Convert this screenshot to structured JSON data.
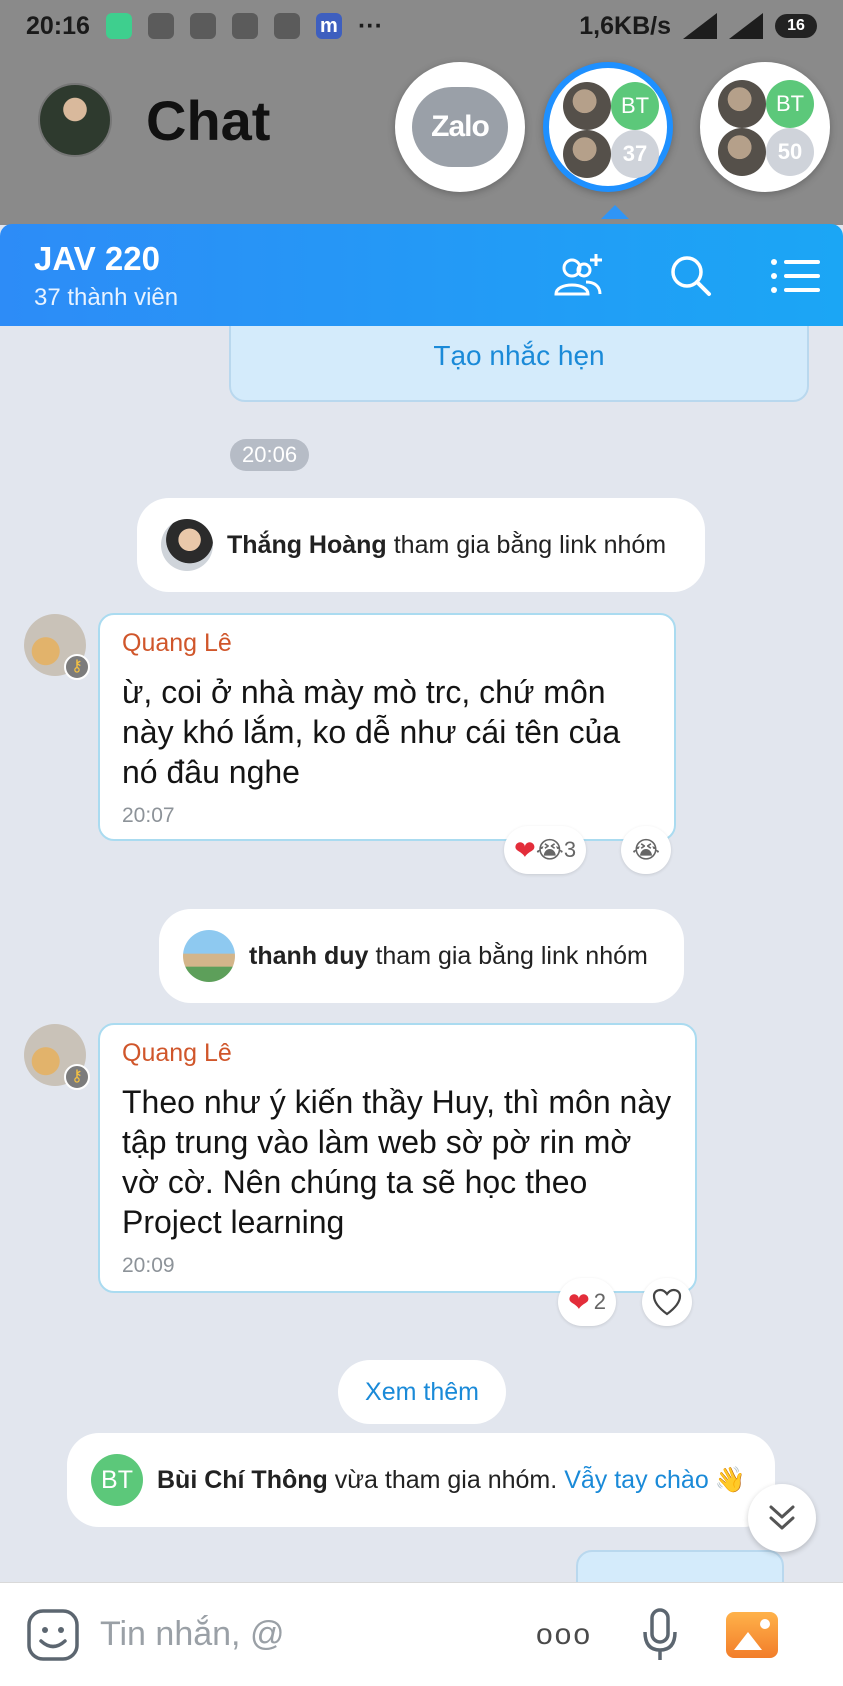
{
  "status_bar": {
    "time": "20:16",
    "network_speed": "1,6KB/s",
    "battery": "16",
    "more": "···",
    "app_icon_letter": "m"
  },
  "background": {
    "title": "Chat",
    "zalo_logo": "Zalo"
  },
  "chat_heads": {
    "group1": {
      "initials": "BT",
      "count": "37"
    },
    "group2": {
      "initials": "BT",
      "count": "50"
    }
  },
  "group_header": {
    "name": "JAV 220",
    "members": "37 thành viên",
    "icons": [
      "add-member-icon",
      "search-icon",
      "menu-icon"
    ]
  },
  "reminder": {
    "button_label": "Tạo nhắc hẹn",
    "time": "20:06"
  },
  "events": [
    {
      "name": "Thắng Hoàng",
      "text": "tham gia bằng link nhóm"
    },
    {
      "name": "thanh duy",
      "text": "tham gia bằng link nhóm"
    }
  ],
  "messages": [
    {
      "sender": "Quang Lê",
      "text": "ừ, coi ở nhà mày mò trc, chứ môn này khó lắm, ko dễ như cái tên của nó đâu nghe",
      "time": "20:07",
      "reaction_count": "3"
    },
    {
      "sender": "Quang Lê",
      "text": "Theo như ý kiến thầy Huy, thì môn này tập trung vào làm web sờ pờ rin mờ vờ cờ. Nên chúng ta sẽ học theo Project learning",
      "time": "20:09",
      "reaction_count": "2"
    }
  ],
  "see_more": "Xem thêm",
  "join_notice": {
    "initials": "BT",
    "name": "Bùi Chí Thông",
    "text": "vừa tham gia nhóm.",
    "wave_link": "Vẫy tay chào",
    "wave_emoji": "👋"
  },
  "input_bar": {
    "placeholder": "Tin nhắn, @",
    "more": "ooo"
  },
  "colors": {
    "header_blue": "#2d8cf7",
    "link_blue": "#1a8ad8",
    "sender_orange": "#d0562b",
    "chat_bg": "#e2e6ee"
  }
}
